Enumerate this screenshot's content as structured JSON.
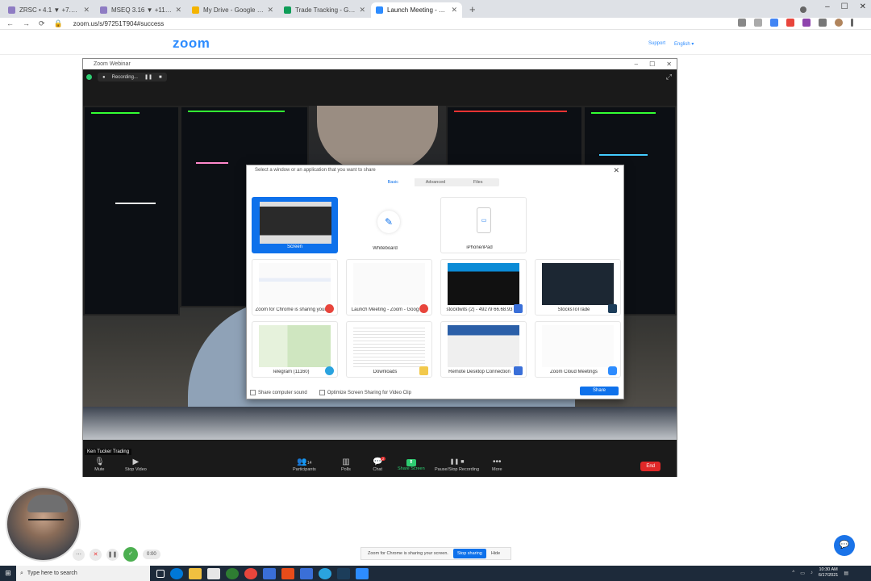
{
  "browser": {
    "tabs": [
      {
        "title": "ZRSC • 4.1 ▼ +7.43 TSM",
        "color": "#8e7cc3"
      },
      {
        "title": "MSEQ 3.16 ▼ +11% FORSKL",
        "color": "#8e7cc3"
      },
      {
        "title": "My Drive - Google Drive",
        "color": "#f4b400"
      },
      {
        "title": "Trade Tracking - Google Sheets",
        "color": "#0f9d58"
      },
      {
        "title": "Launch Meeting - Zoom",
        "color": "#2d8cff"
      }
    ],
    "new_tab": "+",
    "url": "zoom.us/s/97251T904#success",
    "window_controls": [
      "–",
      "☐",
      "✕"
    ]
  },
  "site": {
    "logo": "zoom",
    "support": "Support",
    "language": "English ▾"
  },
  "zoom_window": {
    "title": "Zoom Webinar",
    "window_controls": [
      "–",
      "☐",
      "✕"
    ],
    "recording_label": "Recording...",
    "name_tag": "Ken Tucker Trading",
    "toolbar": [
      {
        "label": "Mute",
        "icon": "🎙",
        "icon_name": "mic-icon"
      },
      {
        "label": "Stop Video",
        "icon": "▶",
        "icon_name": "video-icon"
      },
      {
        "label": "Participants",
        "icon": "👥",
        "icon_name": "participants-icon",
        "count": "14"
      },
      {
        "label": "Polls",
        "icon": "▥",
        "icon_name": "polls-icon"
      },
      {
        "label": "Chat",
        "icon": "💬",
        "icon_name": "chat-icon",
        "badge": "2"
      },
      {
        "label": "Share Screen",
        "icon": "⬆",
        "icon_name": "share-screen-icon"
      },
      {
        "label": "Pause/Stop Recording",
        "icon": "❚❚ ■",
        "icon_name": "recording-icon"
      },
      {
        "label": "More",
        "icon": "•••",
        "icon_name": "more-icon"
      }
    ],
    "end_label": "End"
  },
  "share_dialog": {
    "title": "Select a window or an application that you want to share",
    "tabs": [
      "Basic",
      "Advanced",
      "Files"
    ],
    "tiles": [
      {
        "label": "Screen",
        "selected": true
      },
      {
        "label": "Whiteboard"
      },
      {
        "label": "iPhone/iPad"
      },
      {
        "label": "Zoom for Chrome is sharing your",
        "app": "#e8453c"
      },
      {
        "label": "Launch Meeting - Zoom - Goog",
        "app": "#e8453c"
      },
      {
        "label": "stocktwits (2) - 49279 66.68.93",
        "app": "#3a6fd8"
      },
      {
        "label": "StocksToTrade",
        "app": "#1c3d5a"
      },
      {
        "label": "Telegram (11160)",
        "app": "#2aa3df"
      },
      {
        "label": "Downloads",
        "app": "#f2c94c"
      },
      {
        "label": "Remote Desktop Connection",
        "app": "#3a6fd8"
      },
      {
        "label": "Zoom Cloud Meetings",
        "app": "#2d8cff"
      }
    ],
    "share_sound": "Share computer sound",
    "optimize": "Optimize Screen Sharing for Video Clip",
    "share_button": "Share"
  },
  "floating": {
    "time": "0:00"
  },
  "sharing_bar": {
    "text": "Zoom for Chrome is sharing your screen.",
    "stop": "Stop sharing",
    "hide": "Hide"
  },
  "taskbar": {
    "search_placeholder": "Type here to search",
    "time": "10:30 AM",
    "date": "6/17/2021",
    "icon_colors": [
      "#ffffff",
      "#0078d7",
      "#f0c040",
      "#e6e6e6",
      "#2e7d32",
      "#e8453c",
      "#3a6fd8",
      "#e84c1a",
      "#3a6fd8",
      "#2aa3df",
      "#1c3d5a",
      "#2d8cff"
    ]
  }
}
